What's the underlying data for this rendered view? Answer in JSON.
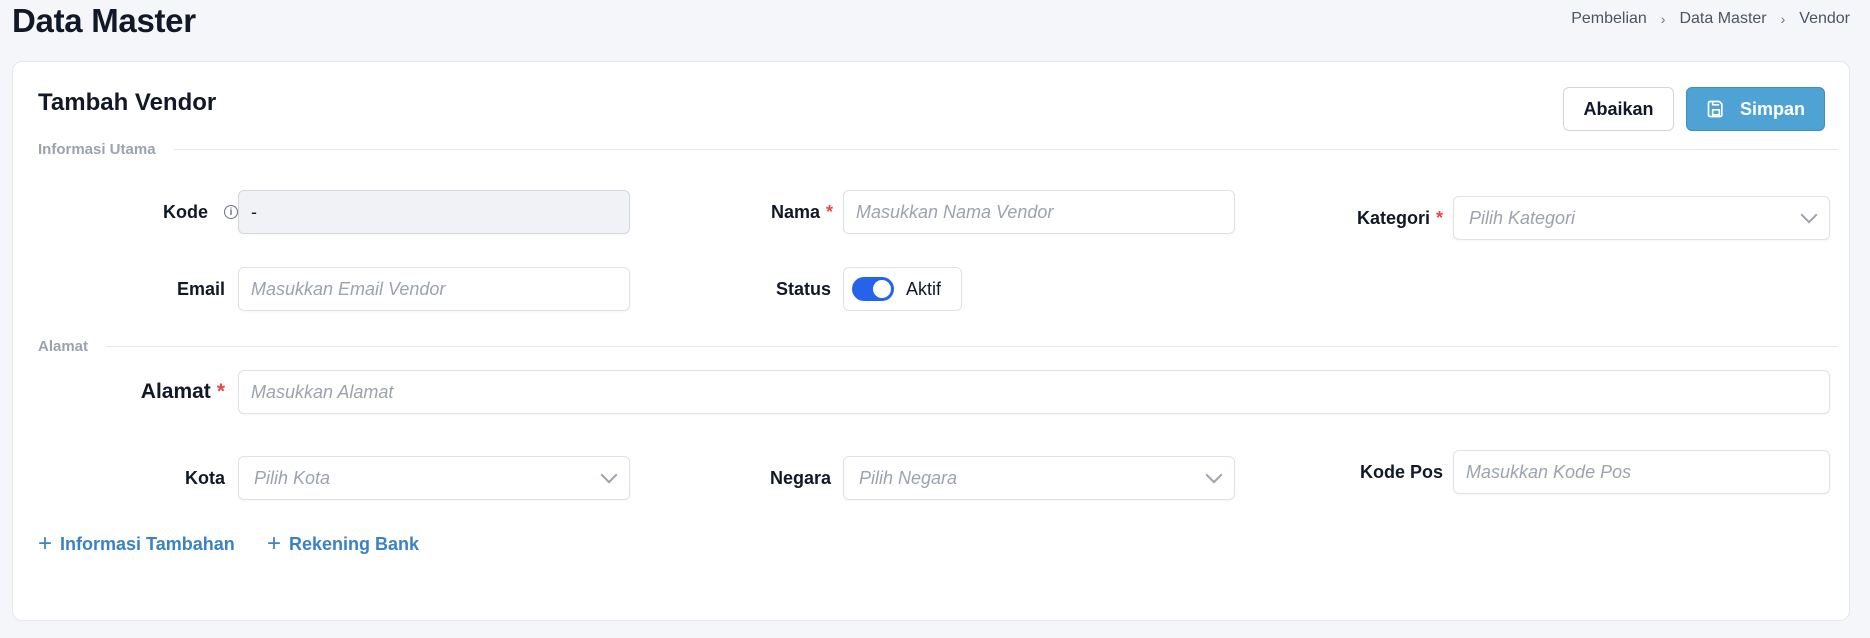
{
  "header": {
    "title": "Data Master",
    "breadcrumb": [
      "Pembelian",
      "Data Master",
      "Vendor"
    ]
  },
  "form": {
    "title": "Tambah Vendor",
    "cancel_label": "Abaikan",
    "save_label": "Simpan",
    "section_main": "Informasi Utama",
    "section_address": "Alamat",
    "kode": {
      "label": "Kode",
      "value": "-"
    },
    "nama": {
      "label": "Nama",
      "placeholder": "Masukkan Nama Vendor"
    },
    "kategori": {
      "label": "Kategori",
      "placeholder": "Pilih Kategori"
    },
    "email": {
      "label": "Email",
      "placeholder": "Masukkan Email Vendor"
    },
    "status": {
      "label": "Status",
      "value": "Aktif"
    },
    "alamat": {
      "label": "Alamat",
      "placeholder": "Masukkan Alamat"
    },
    "kota": {
      "label": "Kota",
      "placeholder": "Pilih Kota"
    },
    "negara": {
      "label": "Negara",
      "placeholder": "Pilih Negara"
    },
    "kode_pos": {
      "label": "Kode Pos",
      "placeholder": "Masukkan Kode Pos"
    },
    "add_info_label": "Informasi Tambahan",
    "add_bank_label": "Rekening Bank",
    "required_mark": "*"
  },
  "colors": {
    "accent": "#4fa3d4",
    "toggle": "#2563eb",
    "required": "#ef4444",
    "link": "#3b82c4"
  }
}
